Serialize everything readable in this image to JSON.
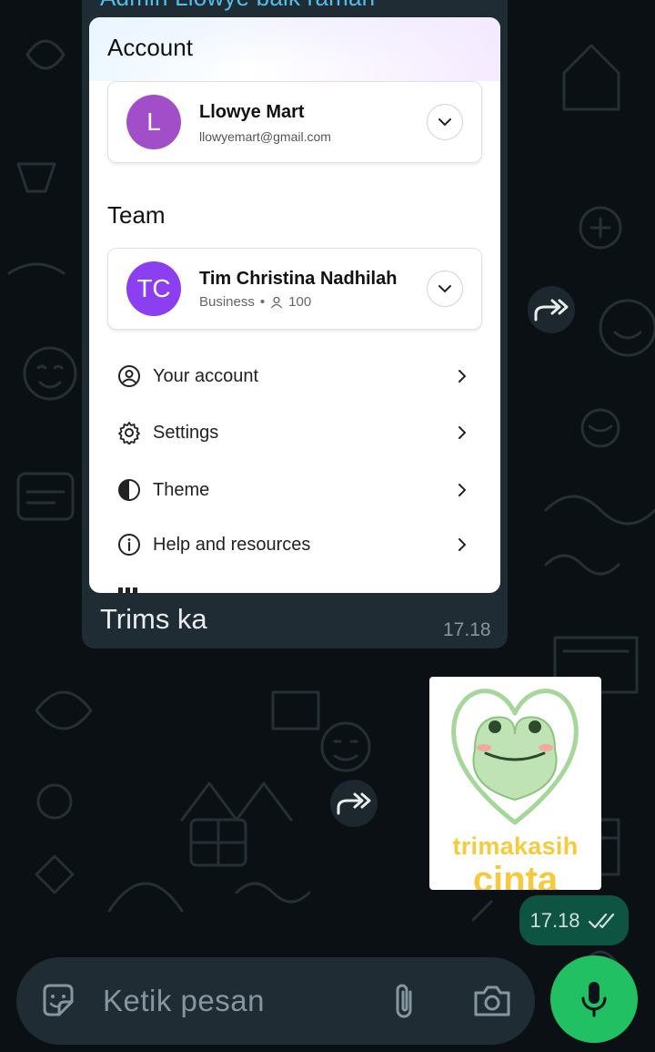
{
  "chat": {
    "sender_name": "Admin Llowye baik ramah",
    "incoming_message": {
      "text": "Trims ka",
      "time": "17.18"
    },
    "screenshot": {
      "account_section": {
        "title": "Account",
        "avatar_letter": "L",
        "name": "Llowye Mart",
        "email": "llowyemart@gmail.com"
      },
      "team_section": {
        "title": "Team",
        "avatar_letters": "TC",
        "name": "Tim Christina Nadhilah",
        "plan": "Business",
        "members": "100"
      },
      "menu": [
        {
          "label": "Your account",
          "icon": "user-circle-icon"
        },
        {
          "label": "Settings",
          "icon": "gear-icon"
        },
        {
          "label": "Theme",
          "icon": "half-circle-icon"
        },
        {
          "label": "Help and resources",
          "icon": "info-icon"
        }
      ]
    },
    "outgoing_sticker": {
      "line1": "trimakasih",
      "line2": "cinta"
    },
    "outgoing_time": "17.18"
  },
  "composer": {
    "placeholder": "Ketik pesan"
  },
  "colors": {
    "background": "#0b1014",
    "incoming_bubble": "#1f2c33",
    "outgoing_bubble": "#0d5443",
    "accent_green": "#21c063",
    "sender_name": "#53bdeb",
    "sticker_text": "#f5cb3d"
  }
}
